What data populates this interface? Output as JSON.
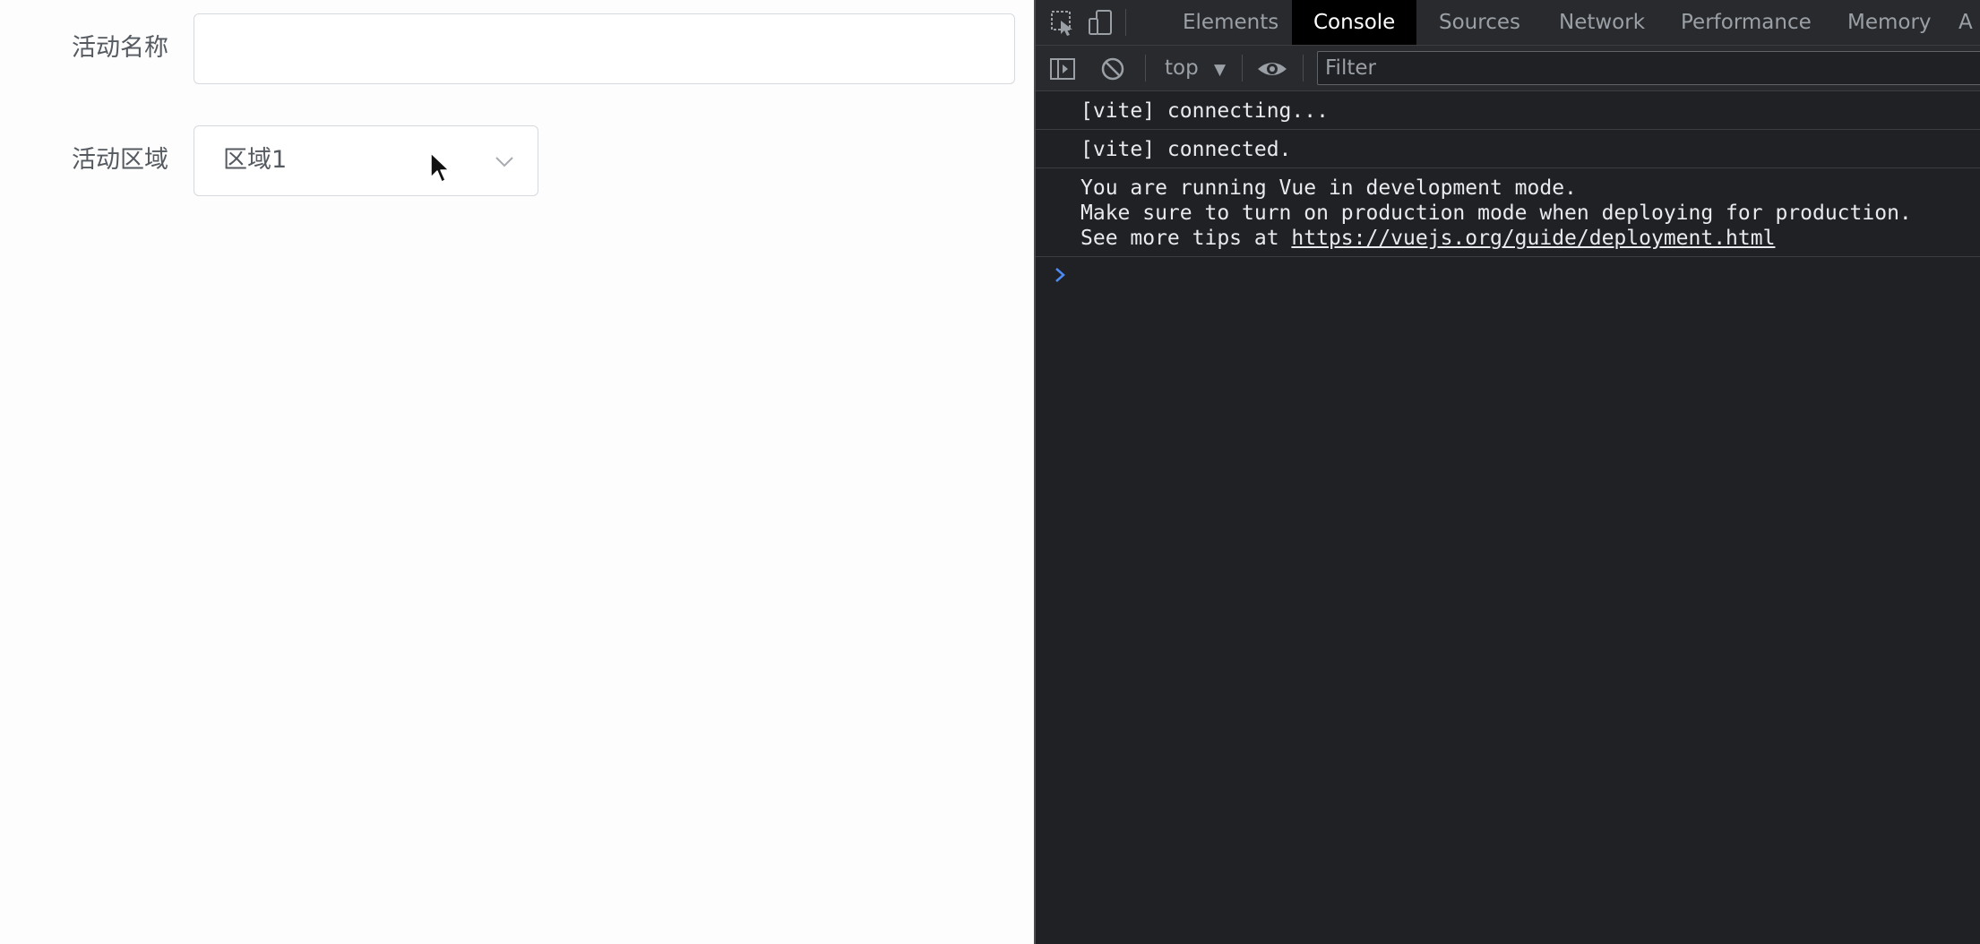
{
  "form": {
    "name_label": "活动名称",
    "name_value": "",
    "region_label": "活动区域",
    "region_value": "区域1"
  },
  "devtools": {
    "tabs": [
      "Elements",
      "Console",
      "Sources",
      "Network",
      "Performance",
      "Memory",
      "A"
    ],
    "active_tab": "Console",
    "context": "top",
    "filter_placeholder": "Filter",
    "log": {
      "line1": "[vite] connecting...",
      "line2": "[vite] connected.",
      "vue_line1": "You are running Vue in development mode.",
      "vue_line2": "Make sure to turn on production mode when deploying for production.",
      "vue_line3_prefix": "See more tips at ",
      "vue_link": "https://vuejs.org/guide/deployment.html"
    }
  },
  "colors": {
    "devtools_bg": "#202124",
    "active_tab_bg": "#000000",
    "prompt_blue": "#4c8bf5"
  }
}
